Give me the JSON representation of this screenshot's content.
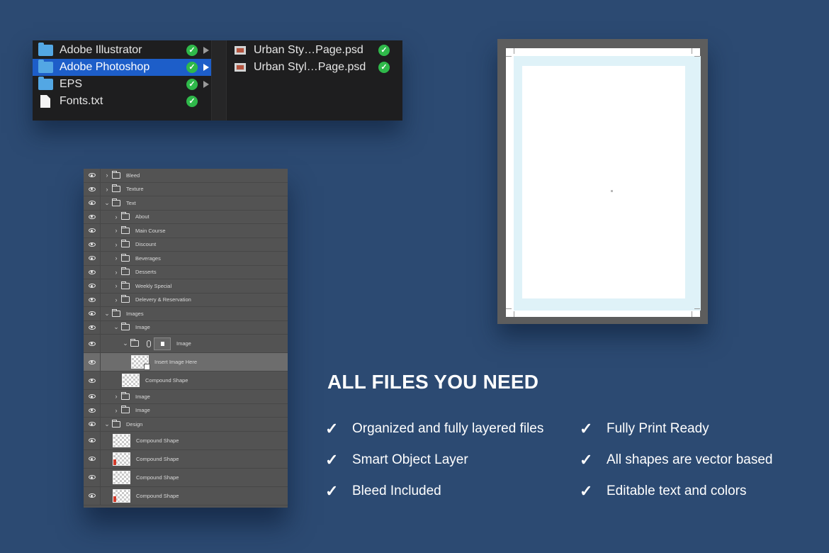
{
  "finder": {
    "column1": [
      {
        "name": "Adobe Illustrator",
        "icon": "folder-icon",
        "synced": true,
        "has_children": true,
        "selected": false
      },
      {
        "name": "Adobe Photoshop",
        "icon": "folder-icon",
        "synced": true,
        "has_children": true,
        "selected": true
      },
      {
        "name": "EPS",
        "icon": "folder-icon",
        "synced": true,
        "has_children": true,
        "selected": false
      },
      {
        "name": "Fonts.txt",
        "icon": "file-icon",
        "synced": true,
        "has_children": false,
        "selected": false
      }
    ],
    "column2": [
      {
        "name": "Urban Sty…Page.psd",
        "icon": "psd-icon",
        "synced": true
      },
      {
        "name": "Urban Styl…Page.psd",
        "icon": "psd-icon",
        "synced": true
      }
    ]
  },
  "layers": {
    "rows": [
      {
        "label": "Bleed",
        "type": "folder",
        "indent": 0,
        "expanded": false
      },
      {
        "label": "Texture",
        "type": "folder",
        "indent": 0,
        "expanded": false
      },
      {
        "label": "Text",
        "type": "folder",
        "indent": 0,
        "expanded": true
      },
      {
        "label": "About",
        "type": "folder",
        "indent": 1,
        "expanded": false
      },
      {
        "label": "Main Course",
        "type": "folder",
        "indent": 1,
        "expanded": false
      },
      {
        "label": "Discount",
        "type": "folder",
        "indent": 1,
        "expanded": false
      },
      {
        "label": "Beverages",
        "type": "folder",
        "indent": 1,
        "expanded": false
      },
      {
        "label": "Desserts",
        "type": "folder",
        "indent": 1,
        "expanded": false
      },
      {
        "label": "Weekly Special",
        "type": "folder",
        "indent": 1,
        "expanded": false
      },
      {
        "label": "Delevery & Reservation",
        "type": "folder",
        "indent": 1,
        "expanded": false
      },
      {
        "label": "Images",
        "type": "folder",
        "indent": 0,
        "expanded": true
      },
      {
        "label": "Image",
        "type": "folder",
        "indent": 1,
        "expanded": true
      },
      {
        "label": "Image",
        "type": "smart-folder",
        "indent": 2,
        "expanded": true
      },
      {
        "label": "Insert Image Here",
        "type": "smart-layer",
        "indent": 3,
        "selected": true
      },
      {
        "label": "Compound Shape",
        "type": "shape",
        "indent": 2
      },
      {
        "label": "Image",
        "type": "folder",
        "indent": 1,
        "expanded": false
      },
      {
        "label": "Image",
        "type": "folder",
        "indent": 1,
        "expanded": false
      },
      {
        "label": "Design",
        "type": "folder",
        "indent": 0,
        "expanded": true
      },
      {
        "label": "Compound Shape",
        "type": "shape",
        "indent": 1
      },
      {
        "label": "Compound Shape",
        "type": "shape-red",
        "indent": 1
      },
      {
        "label": "Compound Shape",
        "type": "shape",
        "indent": 1
      },
      {
        "label": "Compound Shape",
        "type": "shape-red",
        "indent": 1
      }
    ]
  },
  "features": {
    "headline": "ALL FILES YOU NEED",
    "left": [
      "Organized and fully layered files",
      "Smart Object Layer",
      "Bleed Included"
    ],
    "right": [
      "Fully Print Ready",
      "All shapes are vector based",
      "Editable text and colors"
    ],
    "check_symbol": "✓"
  },
  "colors": {
    "background": "#2c4a72",
    "finder_selection": "#1d5ec9",
    "sync_badge": "#2fb94a",
    "folder": "#53a7e4",
    "bleed": "#dff2f8",
    "layers_panel": "#535353"
  }
}
